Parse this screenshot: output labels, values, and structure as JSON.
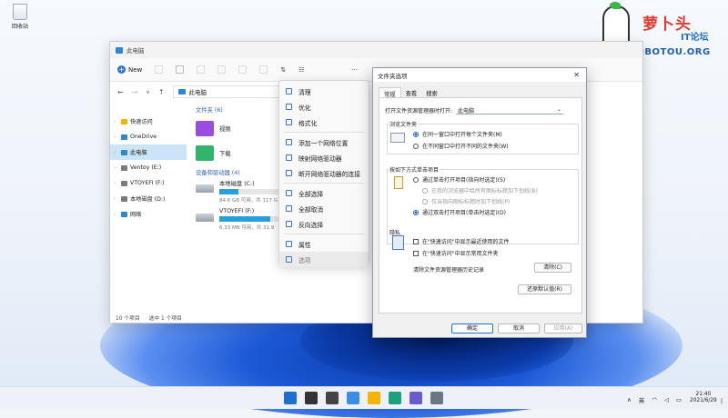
{
  "desktop": {
    "recycle_bin_label": "回收站",
    "logo": {
      "brand": "萝卜头",
      "sub": "IT论坛",
      "url": "BBS.LUOBOTOU.ORG"
    }
  },
  "explorer": {
    "title": "此电脑",
    "toolbar": {
      "new_label": "New",
      "sort_glyph": "⇅",
      "view_glyph": "☷",
      "more_glyph": "···"
    },
    "address": {
      "back": "←",
      "forward": "→",
      "down": "∨",
      "up": "↑",
      "path": "此电脑"
    },
    "sidebar": [
      {
        "label": "快速访问",
        "color": "#f5b400"
      },
      {
        "label": "OneDrive",
        "color": "#2b88d8"
      },
      {
        "label": "此电脑",
        "color": "#2b88d8",
        "selected": true
      },
      {
        "label": "Ventoy (E:)",
        "color": "#7a7a7a"
      },
      {
        "label": "VTOYEFI (F:)",
        "color": "#7a7a7a"
      },
      {
        "label": "本地磁盘 (D:)",
        "color": "#7a7a7a"
      },
      {
        "label": "网络",
        "color": "#2b88d8"
      }
    ],
    "groups": {
      "folders": "文件夹 (6)",
      "drives": "设备和驱动器 (4)"
    },
    "folders": [
      {
        "label": "视频",
        "color": "#9a4be0"
      },
      {
        "label": "下载",
        "color": "#2fb56a"
      }
    ],
    "drives": [
      {
        "label": "本地磁盘 (C:)",
        "detail": "84.6 GB 可用，共 117 G",
        "used_fraction": 0.3
      },
      {
        "label": "VTOYEFI (F:)",
        "detail": "6.33 MB 可用，共 31.9",
        "used_fraction": 0.8
      }
    ],
    "status": {
      "count": "10 个项目",
      "selected": "选中 1 个项目"
    }
  },
  "context_menu": {
    "items": [
      {
        "label": "清理"
      },
      {
        "label": "优化"
      },
      {
        "label": "格式化"
      },
      {
        "label": "添加一个网络位置"
      },
      {
        "label": "映射网络驱动器"
      },
      {
        "label": "断开网络驱动器的连接"
      },
      {
        "label": "全部选择"
      },
      {
        "label": "全部取消"
      },
      {
        "label": "反向选择"
      },
      {
        "label": "属性"
      },
      {
        "label": "选项"
      }
    ]
  },
  "dialog": {
    "title": "文件夹选项",
    "close": "✕",
    "tabs": [
      "常规",
      "查看",
      "搜索"
    ],
    "open_with_label": "打开文件资源管理器时打开:",
    "open_with_value": "此电脑",
    "browse": {
      "title": "浏览文件夹",
      "opt_same": "在同一窗口中打开每个文件夹(M)",
      "opt_new": "在不同窗口中打开不同的文件夹(W)"
    },
    "click": {
      "title": "按如下方式单击项目",
      "single": "通过单击打开项目(指向时选定)(S)",
      "sub1": "在我的浏览器中给所有图标标题加下划线(B)",
      "sub2": "仅当指向图标标题时加下划线(P)",
      "double": "通过双击打开项目(单击时选定)(D)"
    },
    "privacy": {
      "title": "隐私",
      "recent": "在\"快速访问\"中显示最近使用的文件",
      "frequent": "在\"快速访问\"中显示常用文件夹",
      "clear_label": "清除文件资源管理器历史记录",
      "clear_btn": "清除(C)"
    },
    "restore_btn": "还原默认值(R)",
    "ok": "确定",
    "cancel": "取消",
    "apply": "应用(A)"
  },
  "taskbar": {
    "icons": [
      {
        "name": "start",
        "color": "#1f6fd0"
      },
      {
        "name": "search",
        "color": "#333333"
      },
      {
        "name": "taskview",
        "color": "#444444"
      },
      {
        "name": "widgets",
        "color": "#3a8ee6"
      },
      {
        "name": "explorer",
        "color": "#f5b400"
      },
      {
        "name": "edge",
        "color": "#1aa37a"
      },
      {
        "name": "store",
        "color": "#6a5acd"
      },
      {
        "name": "settings",
        "color": "#6b7785"
      }
    ],
    "tray_expand": "∧",
    "ime": "英",
    "time": "21:40",
    "date": "2021/6/29"
  }
}
